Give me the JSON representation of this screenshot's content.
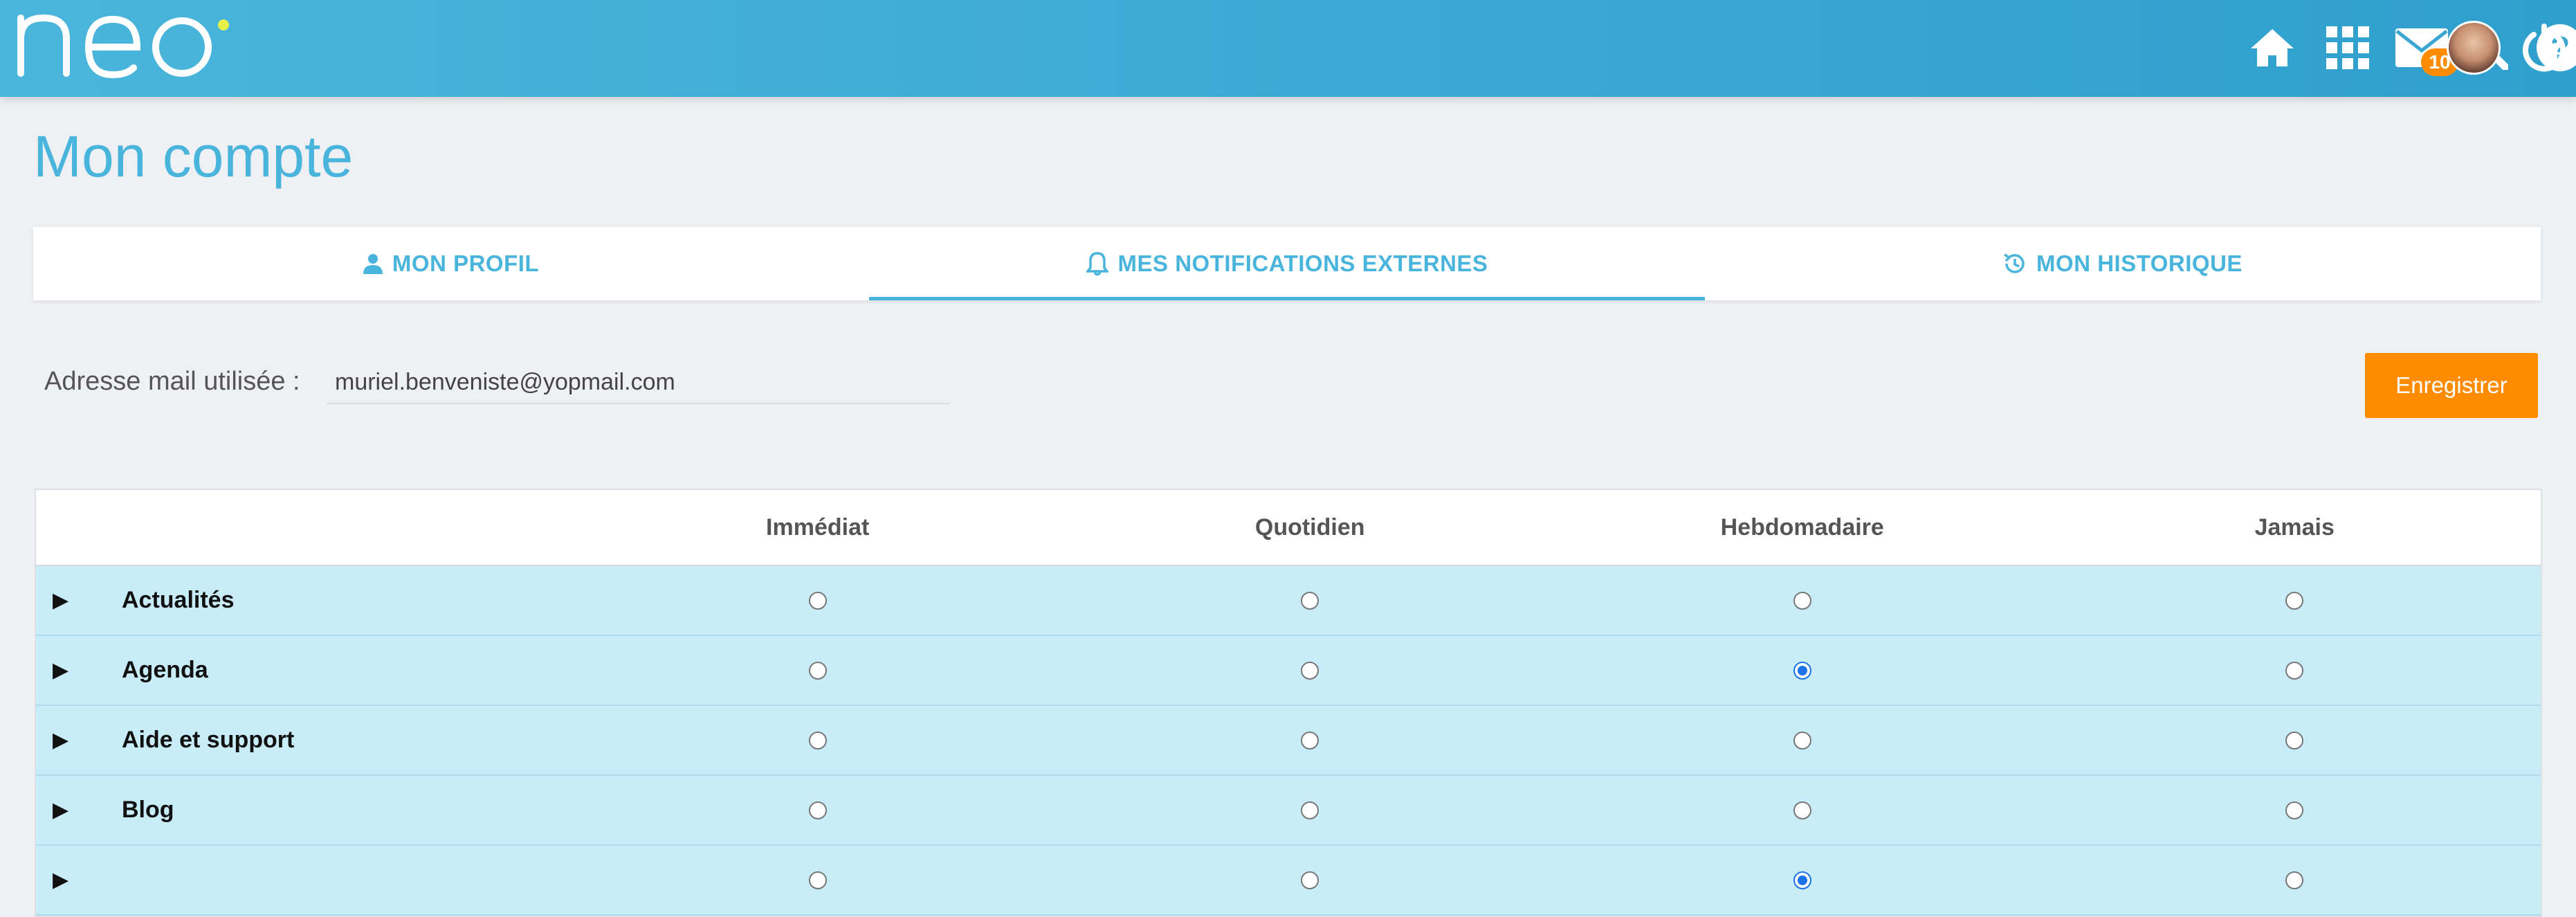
{
  "header": {
    "logo_text": "neo",
    "mail_badge": "10",
    "accent_color": "#4ab5dc",
    "icons": [
      "home-icon",
      "apps-grid-icon",
      "mail-icon",
      "search-icon",
      "help-icon",
      "avatar",
      "power-icon"
    ]
  },
  "page": {
    "title": "Mon compte"
  },
  "tabs": [
    {
      "label": "MON PROFIL",
      "icon": "person-icon",
      "active": false
    },
    {
      "label": "MES NOTIFICATIONS EXTERNES",
      "icon": "bell-icon",
      "active": true
    },
    {
      "label": "MON HISTORIQUE",
      "icon": "history-icon",
      "active": false
    }
  ],
  "email": {
    "label": "Adresse mail utilisée :",
    "value": "muriel.benveniste@yopmail.com"
  },
  "save_button": {
    "label": "Enregistrer",
    "color": "#ff8c00"
  },
  "table": {
    "columns": [
      "Immédiat",
      "Quotidien",
      "Hebdomadaire",
      "Jamais"
    ],
    "rows": [
      {
        "name": "Actualités",
        "selected": null
      },
      {
        "name": "Agenda",
        "selected": "Hebdomadaire"
      },
      {
        "name": "Aide et support",
        "selected": null
      },
      {
        "name": "Blog",
        "selected": null
      }
    ]
  }
}
